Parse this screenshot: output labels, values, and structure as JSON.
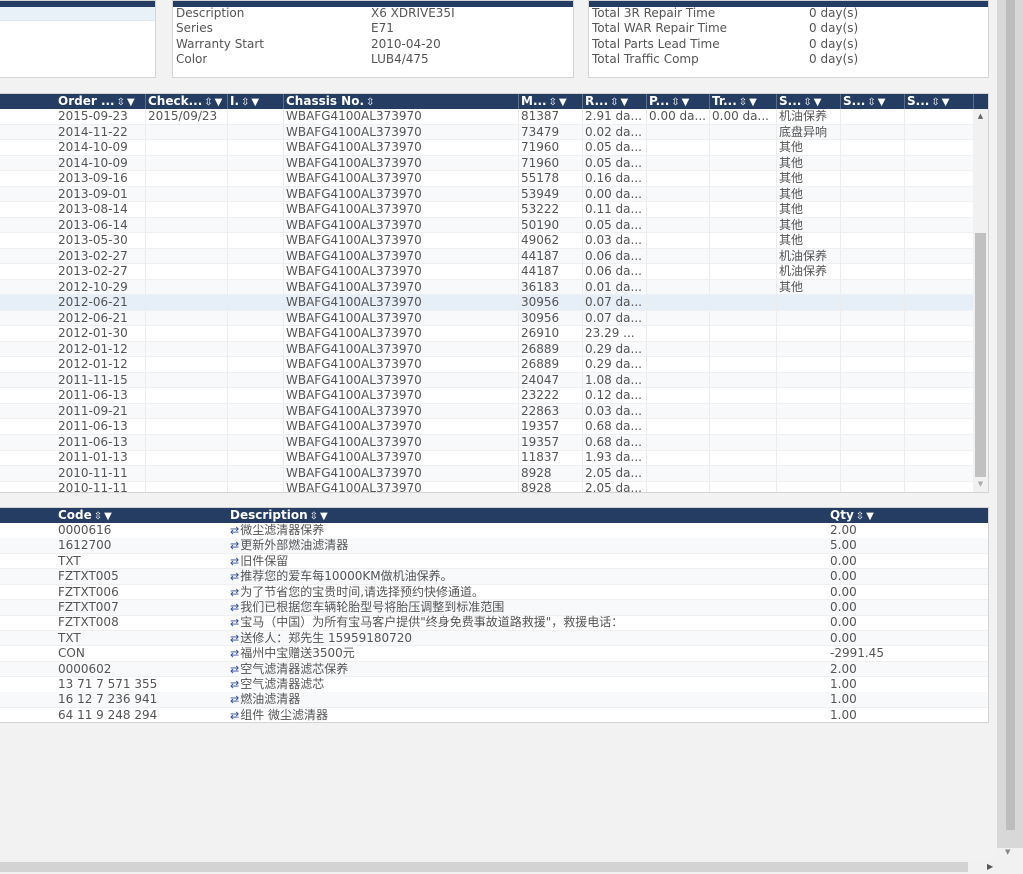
{
  "vehicle": {
    "fields": [
      {
        "label": "Description",
        "value": "X6 XDRIVE35I"
      },
      {
        "label": "Series",
        "value": "E71"
      },
      {
        "label": "Warranty Start",
        "value": "2010-04-20"
      },
      {
        "label": "Color",
        "value": "LUB4/475"
      }
    ]
  },
  "repair_stats": {
    "fields": [
      {
        "label": "Total 3R Repair Time",
        "value": "0 day(s)"
      },
      {
        "label": "Total WAR Repair Time",
        "value": "0 day(s)"
      },
      {
        "label": "Total Parts Lead Time",
        "value": "0 day(s)"
      },
      {
        "label": "Total Traffic Comp",
        "value": "0 day(s)"
      }
    ]
  },
  "history": {
    "columns": [
      "Order ...",
      "Check...",
      "I.",
      "Chassis No.",
      "M...",
      "R...",
      "P...",
      "Tr...",
      "S...",
      "S...",
      "S..."
    ],
    "sort_icon": "⇳",
    "filter_icon": "▼",
    "rows": [
      [
        "2015-09-23",
        "2015/09/23",
        "",
        "WBAFG4100AL373970",
        "81387",
        "2.91 da...",
        "0.00 da...",
        "0.00 da...",
        "机油保养",
        "",
        ""
      ],
      [
        "2014-11-22",
        "",
        "",
        "WBAFG4100AL373970",
        "73479",
        "0.02 da...",
        "",
        "",
        "底盘异响",
        "",
        ""
      ],
      [
        "2014-10-09",
        "",
        "",
        "WBAFG4100AL373970",
        "71960",
        "0.05 da...",
        "",
        "",
        "其他",
        "",
        ""
      ],
      [
        "2014-10-09",
        "",
        "",
        "WBAFG4100AL373970",
        "71960",
        "0.05 da...",
        "",
        "",
        "其他",
        "",
        ""
      ],
      [
        "2013-09-16",
        "",
        "",
        "WBAFG4100AL373970",
        "55178",
        "0.16 da...",
        "",
        "",
        "其他",
        "",
        ""
      ],
      [
        "2013-09-01",
        "",
        "",
        "WBAFG4100AL373970",
        "53949",
        "0.00 da...",
        "",
        "",
        "其他",
        "",
        ""
      ],
      [
        "2013-08-14",
        "",
        "",
        "WBAFG4100AL373970",
        "53222",
        "0.11 da...",
        "",
        "",
        "其他",
        "",
        ""
      ],
      [
        "2013-06-14",
        "",
        "",
        "WBAFG4100AL373970",
        "50190",
        "0.05 da...",
        "",
        "",
        "其他",
        "",
        ""
      ],
      [
        "2013-05-30",
        "",
        "",
        "WBAFG4100AL373970",
        "49062",
        "0.03 da...",
        "",
        "",
        "其他",
        "",
        ""
      ],
      [
        "2013-02-27",
        "",
        "",
        "WBAFG4100AL373970",
        "44187",
        "0.06 da...",
        "",
        "",
        "机油保养",
        "",
        ""
      ],
      [
        "2013-02-27",
        "",
        "",
        "WBAFG4100AL373970",
        "44187",
        "0.06 da...",
        "",
        "",
        "机油保养",
        "",
        ""
      ],
      [
        "2012-10-29",
        "",
        "",
        "WBAFG4100AL373970",
        "36183",
        "0.01 da...",
        "",
        "",
        "其他",
        "",
        ""
      ],
      [
        "2012-06-21",
        "",
        "",
        "WBAFG4100AL373970",
        "30956",
        "0.07 da...",
        "",
        "",
        "",
        "",
        ""
      ],
      [
        "2012-06-21",
        "",
        "",
        "WBAFG4100AL373970",
        "30956",
        "0.07 da...",
        "",
        "",
        "",
        "",
        ""
      ],
      [
        "2012-01-30",
        "",
        "",
        "WBAFG4100AL373970",
        "26910",
        "23.29 ...",
        "",
        "",
        "",
        "",
        ""
      ],
      [
        "2012-01-12",
        "",
        "",
        "WBAFG4100AL373970",
        "26889",
        "0.29 da...",
        "",
        "",
        "",
        "",
        ""
      ],
      [
        "2012-01-12",
        "",
        "",
        "WBAFG4100AL373970",
        "26889",
        "0.29 da...",
        "",
        "",
        "",
        "",
        ""
      ],
      [
        "2011-11-15",
        "",
        "",
        "WBAFG4100AL373970",
        "24047",
        "1.08 da...",
        "",
        "",
        "",
        "",
        ""
      ],
      [
        "2011-06-13",
        "",
        "",
        "WBAFG4100AL373970",
        "23222",
        "0.12 da...",
        "",
        "",
        "",
        "",
        ""
      ],
      [
        "2011-09-21",
        "",
        "",
        "WBAFG4100AL373970",
        "22863",
        "0.03 da...",
        "",
        "",
        "",
        "",
        ""
      ],
      [
        "2011-06-13",
        "",
        "",
        "WBAFG4100AL373970",
        "19357",
        "0.68 da...",
        "",
        "",
        "",
        "",
        ""
      ],
      [
        "2011-06-13",
        "",
        "",
        "WBAFG4100AL373970",
        "19357",
        "0.68 da...",
        "",
        "",
        "",
        "",
        ""
      ],
      [
        "2011-01-13",
        "",
        "",
        "WBAFG4100AL373970",
        "11837",
        "1.93 da...",
        "",
        "",
        "",
        "",
        ""
      ],
      [
        "2010-11-11",
        "",
        "",
        "WBAFG4100AL373970",
        "8928",
        "2.05 da...",
        "",
        "",
        "",
        "",
        ""
      ],
      [
        "2010-11-11",
        "",
        "",
        "WBAFG4100AL373970",
        "8928",
        "2.05 da...",
        "",
        "",
        "",
        "",
        ""
      ]
    ],
    "selected_row": 12,
    "scroll": {
      "up_icon": "▲",
      "down_icon": "▼"
    }
  },
  "parts": {
    "columns": [
      "Code",
      "Description",
      "Qty"
    ],
    "link_icon": "⇄",
    "rows": [
      [
        "0000616",
        "微尘滤清器保养",
        "2.00"
      ],
      [
        "1612700",
        "更新外部燃油滤清器",
        "5.00"
      ],
      [
        "TXT",
        "旧件保留",
        "0.00"
      ],
      [
        "FZTXT005",
        "推荐您的爱车每10000KM做机油保养。",
        "0.00"
      ],
      [
        "FZTXT006",
        "为了节省您的宝贵时间,请选择预约快修通道。",
        "0.00"
      ],
      [
        "FZTXT007",
        "我们已根据您车辆轮胎型号将胎压调整到标准范围",
        "0.00"
      ],
      [
        "FZTXT008",
        "宝马（中国）为所有宝马客户提供\"终身免费事故道路救援\"，救援电话：",
        "0.00"
      ],
      [
        "TXT",
        "送修人：郑先生 15959180720",
        "0.00"
      ],
      [
        "CON",
        "福州中宝赠送3500元",
        "-2991.45"
      ],
      [
        "0000602",
        "空气滤清器滤芯保养",
        "2.00"
      ],
      [
        "13 71 7 571 355",
        "空气滤清器滤芯",
        "1.00"
      ],
      [
        "16 12 7 236 941",
        "燃油滤清器",
        "1.00"
      ],
      [
        "64 11 9 248 294",
        "组件 微尘滤清器",
        "1.00"
      ]
    ]
  },
  "window": {
    "vscroll_down_icon": "▼",
    "hscroll_right_icon": "▶"
  }
}
